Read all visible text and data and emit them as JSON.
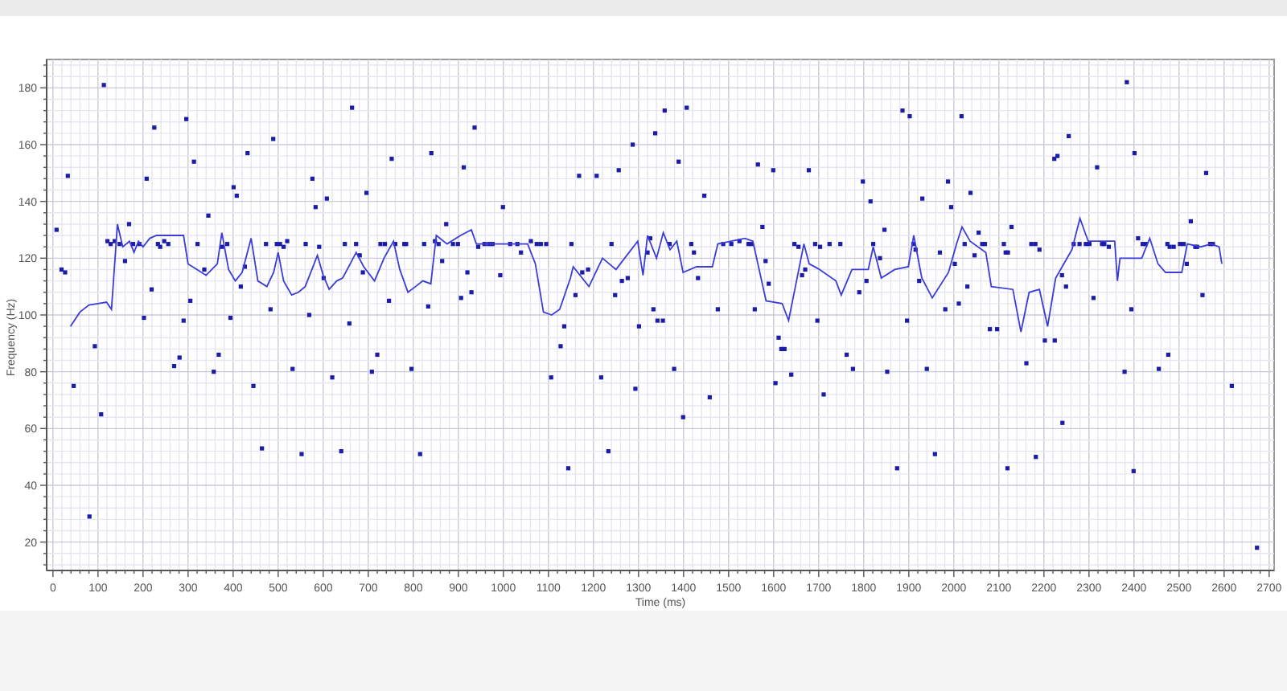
{
  "chart": {
    "chart_data": {
      "type": "scatter",
      "xlabel": "Time (ms)",
      "ylabel": "Frequency (Hz)",
      "xlim": [
        -14,
        2711
      ],
      "ylim": [
        10,
        190
      ],
      "xticks": [
        0,
        100,
        200,
        300,
        400,
        500,
        600,
        700,
        800,
        900,
        1000,
        1100,
        1200,
        1300,
        1400,
        1500,
        1600,
        1700,
        1800,
        1900,
        2000,
        2100,
        2200,
        2300,
        2400,
        2500,
        2600,
        2700
      ],
      "yticks": [
        20,
        40,
        60,
        80,
        100,
        120,
        140,
        160,
        180
      ],
      "grid": true,
      "series": [
        {
          "color": "#1c1ca8",
          "x": [
            8,
            19,
            27,
            33,
            46,
            81,
            93,
            107,
            113,
            121,
            128,
            137,
            148,
            160,
            169,
            178,
            192,
            202,
            208,
            219,
            225,
            233,
            238,
            247,
            256,
            269,
            281,
            290,
            296,
            305,
            313,
            321,
            336,
            345,
            357,
            368,
            375,
            387,
            394,
            401,
            408,
            417,
            426,
            432,
            445,
            464,
            473,
            483,
            489,
            497,
            504,
            512,
            520,
            532,
            552,
            561,
            569,
            576,
            583,
            591,
            601,
            608,
            620,
            640,
            648,
            658,
            664,
            673,
            681,
            688,
            696,
            708,
            720,
            727,
            737,
            746,
            752,
            760,
            780,
            784,
            796,
            815,
            824,
            833,
            840,
            848,
            856,
            864,
            873,
            888,
            899,
            906,
            912,
            920,
            929,
            936,
            944,
            958,
            968,
            976,
            993,
            999,
            1015,
            1031,
            1039,
            1061,
            1074,
            1083,
            1095,
            1106,
            1127,
            1135,
            1144,
            1151,
            1160,
            1168,
            1175,
            1188,
            1207,
            1217,
            1233,
            1240,
            1248,
            1256,
            1263,
            1276,
            1287,
            1293,
            1301,
            1320,
            1326,
            1333,
            1337,
            1342,
            1354,
            1358,
            1369,
            1379,
            1389,
            1399,
            1407,
            1417,
            1423,
            1432,
            1446,
            1458,
            1476,
            1488,
            1506,
            1524,
            1544,
            1551,
            1558,
            1565,
            1575,
            1582,
            1589,
            1599,
            1604,
            1611,
            1617,
            1624,
            1639,
            1646,
            1655,
            1663,
            1670,
            1678,
            1692,
            1697,
            1703,
            1711,
            1724,
            1748,
            1762,
            1776,
            1790,
            1798,
            1806,
            1815,
            1821,
            1836,
            1846,
            1852,
            1874,
            1886,
            1896,
            1902,
            1910,
            1915,
            1923,
            1930,
            1940,
            1958,
            1969,
            1981,
            1987,
            1994,
            2002,
            2011,
            2017,
            2024,
            2030,
            2037,
            2046,
            2055,
            2063,
            2069,
            2080,
            2096,
            2111,
            2115,
            2119,
            2120,
            2128,
            2161,
            2172,
            2181,
            2182,
            2190,
            2202,
            2223,
            2224,
            2230,
            2240,
            2241,
            2249,
            2255,
            2266,
            2279,
            2293,
            2301,
            2310,
            2318,
            2329,
            2334,
            2344,
            2379,
            2384,
            2394,
            2399,
            2401,
            2409,
            2419,
            2426,
            2455,
            2474,
            2476,
            2479,
            2488,
            2502,
            2510,
            2517,
            2526,
            2536,
            2540,
            2552,
            2560,
            2569,
            2575,
            2617,
            2673
          ],
          "values": [
            130,
            116,
            115,
            149,
            75,
            29,
            89,
            65,
            181,
            126,
            125,
            126,
            125,
            119,
            132,
            125,
            125,
            99,
            148,
            109,
            166,
            125,
            124,
            126,
            125,
            82,
            85,
            98,
            169,
            105,
            154,
            125,
            116,
            135,
            80,
            86,
            124,
            125,
            99,
            145,
            142,
            110,
            117,
            157,
            75,
            53,
            125,
            102,
            162,
            125,
            125,
            124,
            126,
            81,
            51,
            125,
            100,
            148,
            138,
            124,
            113,
            141,
            78,
            52,
            125,
            97,
            173,
            125,
            121,
            115,
            143,
            80,
            86,
            125,
            125,
            105,
            155,
            125,
            125,
            125,
            81,
            51,
            125,
            103,
            157,
            126,
            125,
            119,
            132,
            125,
            125,
            106,
            152,
            115,
            108,
            166,
            124,
            125,
            125,
            125,
            114,
            138,
            125,
            125,
            122,
            126,
            125,
            125,
            125,
            78,
            89,
            96,
            46,
            125,
            107,
            149,
            115,
            116,
            149,
            78,
            52,
            125,
            107,
            151,
            112,
            113,
            160,
            74,
            96,
            122,
            127,
            102,
            164,
            98,
            98,
            172,
            125,
            81,
            154,
            64,
            173,
            125,
            122,
            113,
            142,
            71,
            102,
            125,
            125,
            126,
            125,
            125,
            102,
            153,
            131,
            119,
            111,
            151,
            76,
            92,
            88,
            88,
            79,
            125,
            124,
            114,
            116,
            151,
            125,
            98,
            124,
            72,
            125,
            125,
            86,
            81,
            108,
            147,
            112,
            140,
            125,
            120,
            130,
            80,
            46,
            172,
            98,
            170,
            125,
            123,
            112,
            141,
            81,
            51,
            122,
            102,
            147,
            138,
            118,
            104,
            170,
            125,
            110,
            143,
            121,
            129,
            125,
            125,
            95,
            95,
            125,
            122,
            46,
            122,
            131,
            83,
            125,
            125,
            50,
            123,
            91,
            155,
            91,
            156,
            114,
            62,
            110,
            163,
            125,
            125,
            125,
            125,
            106,
            152,
            125,
            125,
            124,
            80,
            182,
            102,
            45,
            157,
            127,
            125,
            125,
            81,
            125,
            86,
            124,
            124,
            125,
            125,
            118,
            133,
            124,
            124,
            107,
            150,
            125,
            125,
            75,
            18
          ]
        },
        {
          "type": "line",
          "color": "#3c3cd8",
          "x": [
            39,
            60,
            80,
            100,
            119,
            130,
            143,
            155,
            170,
            180,
            190,
            200,
            215,
            230,
            250,
            270,
            290,
            300,
            320,
            340,
            365,
            375,
            390,
            405,
            420,
            440,
            455,
            475,
            490,
            500,
            512,
            530,
            545,
            560,
            575,
            587,
            600,
            613,
            630,
            643,
            660,
            673,
            690,
            714,
            735,
            756,
            770,
            788,
            805,
            821,
            839,
            851,
            875,
            905,
            929,
            940,
            1000,
            1054,
            1071,
            1089,
            1107,
            1125,
            1149,
            1155,
            1190,
            1220,
            1250,
            1298,
            1310,
            1320,
            1340,
            1355,
            1370,
            1385,
            1399,
            1429,
            1464,
            1476,
            1536,
            1554,
            1565,
            1583,
            1619,
            1633,
            1667,
            1679,
            1702,
            1738,
            1750,
            1774,
            1810,
            1821,
            1839,
            1869,
            1899,
            1911,
            1929,
            1952,
            1988,
            2006,
            2018,
            2036,
            2071,
            2083,
            2131,
            2149,
            2167,
            2190,
            2208,
            2226,
            2262,
            2280,
            2298,
            2345,
            2357,
            2363,
            2369,
            2417,
            2435,
            2453,
            2470,
            2506,
            2518,
            2548,
            2571,
            2589,
            2595
          ],
          "values": [
            96,
            101,
            103.5,
            104,
            104.5,
            102,
            132,
            124,
            126,
            122,
            126,
            124,
            127,
            128,
            128,
            128,
            128,
            118,
            116,
            114,
            118,
            129,
            116,
            112,
            115,
            127,
            112,
            110,
            115,
            122,
            112,
            107,
            108,
            110,
            116,
            121,
            114,
            109,
            112,
            113,
            118,
            122,
            117,
            112,
            120,
            126,
            116,
            108,
            110,
            112,
            111,
            128,
            125,
            128,
            130,
            125,
            125,
            125,
            118,
            101,
            100,
            102,
            113,
            117,
            110,
            120,
            116,
            126,
            114,
            128,
            120,
            129,
            123,
            126,
            115,
            117,
            117,
            125,
            127,
            126,
            118,
            105,
            104,
            98,
            125,
            118,
            116,
            112,
            107,
            116,
            116,
            124,
            113,
            116,
            117,
            128,
            113,
            106,
            115,
            125,
            131,
            126,
            122,
            110,
            109,
            94,
            108,
            109,
            96,
            113,
            123,
            134,
            126,
            126,
            126,
            112,
            120,
            120,
            127,
            118,
            115,
            115,
            125,
            124,
            125,
            124,
            118
          ]
        }
      ]
    }
  }
}
